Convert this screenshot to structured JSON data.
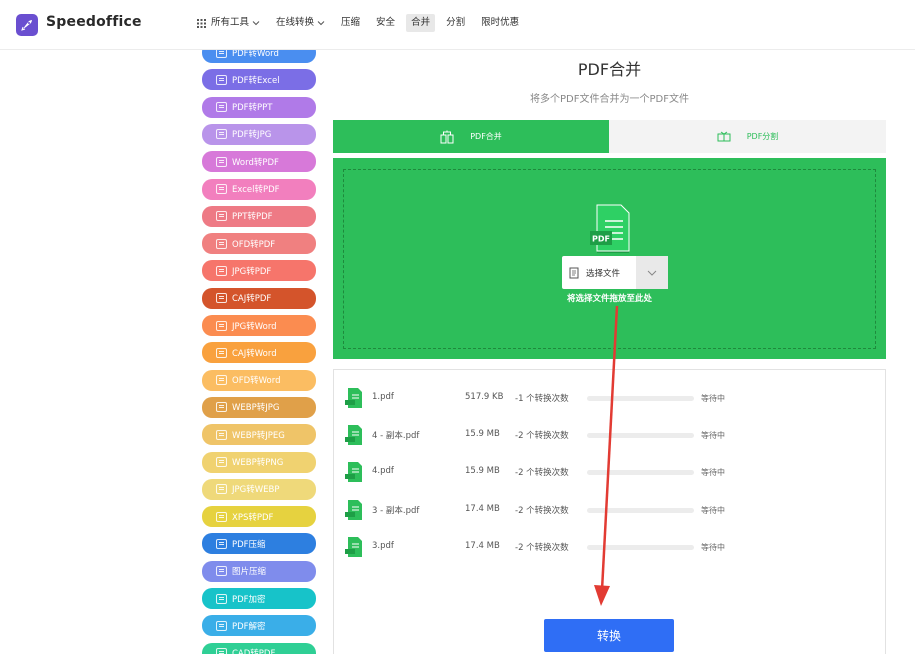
{
  "brand": {
    "name": "Speedoffice",
    "logo_color": "#6a4fd0"
  },
  "nav": {
    "items": [
      {
        "label": "所有工具",
        "has_dropdown": true,
        "icon": "grid-icon"
      },
      {
        "label": "在线转换",
        "has_dropdown": true
      },
      {
        "label": "压缩"
      },
      {
        "label": "安全"
      },
      {
        "label": "合并",
        "active": true
      },
      {
        "label": "分割"
      },
      {
        "label": "限时优惠"
      }
    ]
  },
  "sidebar": {
    "items": [
      {
        "label": "PDF转Word",
        "color": "#4a8ef0"
      },
      {
        "label": "PDF转Excel",
        "color": "#7b6ee6"
      },
      {
        "label": "PDF转PPT",
        "color": "#b07ae8"
      },
      {
        "label": "PDF转JPG",
        "color": "#b994ea"
      },
      {
        "label": "Word转PDF",
        "color": "#d779d9"
      },
      {
        "label": "Excel转PDF",
        "color": "#f27fbe"
      },
      {
        "label": "PPT转PDF",
        "color": "#ee7a85"
      },
      {
        "label": "OFD转PDF",
        "color": "#f08080"
      },
      {
        "label": "JPG转PDF",
        "color": "#f6756b"
      },
      {
        "label": "CAJ转PDF",
        "color": "#d4542b"
      },
      {
        "label": "JPG转Word",
        "color": "#fb8c50"
      },
      {
        "label": "CAJ转Word",
        "color": "#f9a13e"
      },
      {
        "label": "OFD转Word",
        "color": "#fbbd62"
      },
      {
        "label": "WEBP转JPG",
        "color": "#e0a049"
      },
      {
        "label": "WEBP转JPEG",
        "color": "#efc468"
      },
      {
        "label": "WEBP转PNG",
        "color": "#f0d270"
      },
      {
        "label": "JPG转WEBP",
        "color": "#efd97a"
      },
      {
        "label": "XPS转PDF",
        "color": "#e6d23f"
      },
      {
        "label": "PDF压缩",
        "color": "#2d7fe0"
      },
      {
        "label": "图片压缩",
        "color": "#7f8cec"
      },
      {
        "label": "PDF加密",
        "color": "#17c3c9"
      },
      {
        "label": "PDF解密",
        "color": "#3aaee8"
      },
      {
        "label": "CAD转PDF",
        "color": "#2fcf95"
      }
    ]
  },
  "main": {
    "title": "PDF合并",
    "subtitle": "将多个PDF文件合并为一个PDF文件",
    "tabs": [
      {
        "label": "PDF合并",
        "active": true
      },
      {
        "label": "PDF分割",
        "active": false
      }
    ],
    "dropzone": {
      "choose_label": "选择文件",
      "hint": "将选择文件拖放至此处",
      "badge": "PDF"
    },
    "files": [
      {
        "name": "1.pdf",
        "size": "517.9 KB",
        "count": "-1 个转换次数",
        "status": "等待中",
        "progress": 0
      },
      {
        "name": "4 - 副本.pdf",
        "size": "15.9 MB",
        "count": "-2 个转换次数",
        "status": "等待中",
        "progress": 0
      },
      {
        "name": "4.pdf",
        "size": "15.9 MB",
        "count": "-2 个转换次数",
        "status": "等待中",
        "progress": 0
      },
      {
        "name": "3 - 副本.pdf",
        "size": "17.4 MB",
        "count": "-2 个转换次数",
        "status": "等待中",
        "progress": 0
      },
      {
        "name": "3.pdf",
        "size": "17.4 MB",
        "count": "-2 个转换次数",
        "status": "等待中",
        "progress": 0
      }
    ],
    "convert_label": "转换"
  },
  "colors": {
    "green": "#2dbe5a",
    "blue_button": "#2f6ef5",
    "annotation_red": "#e23b33"
  }
}
